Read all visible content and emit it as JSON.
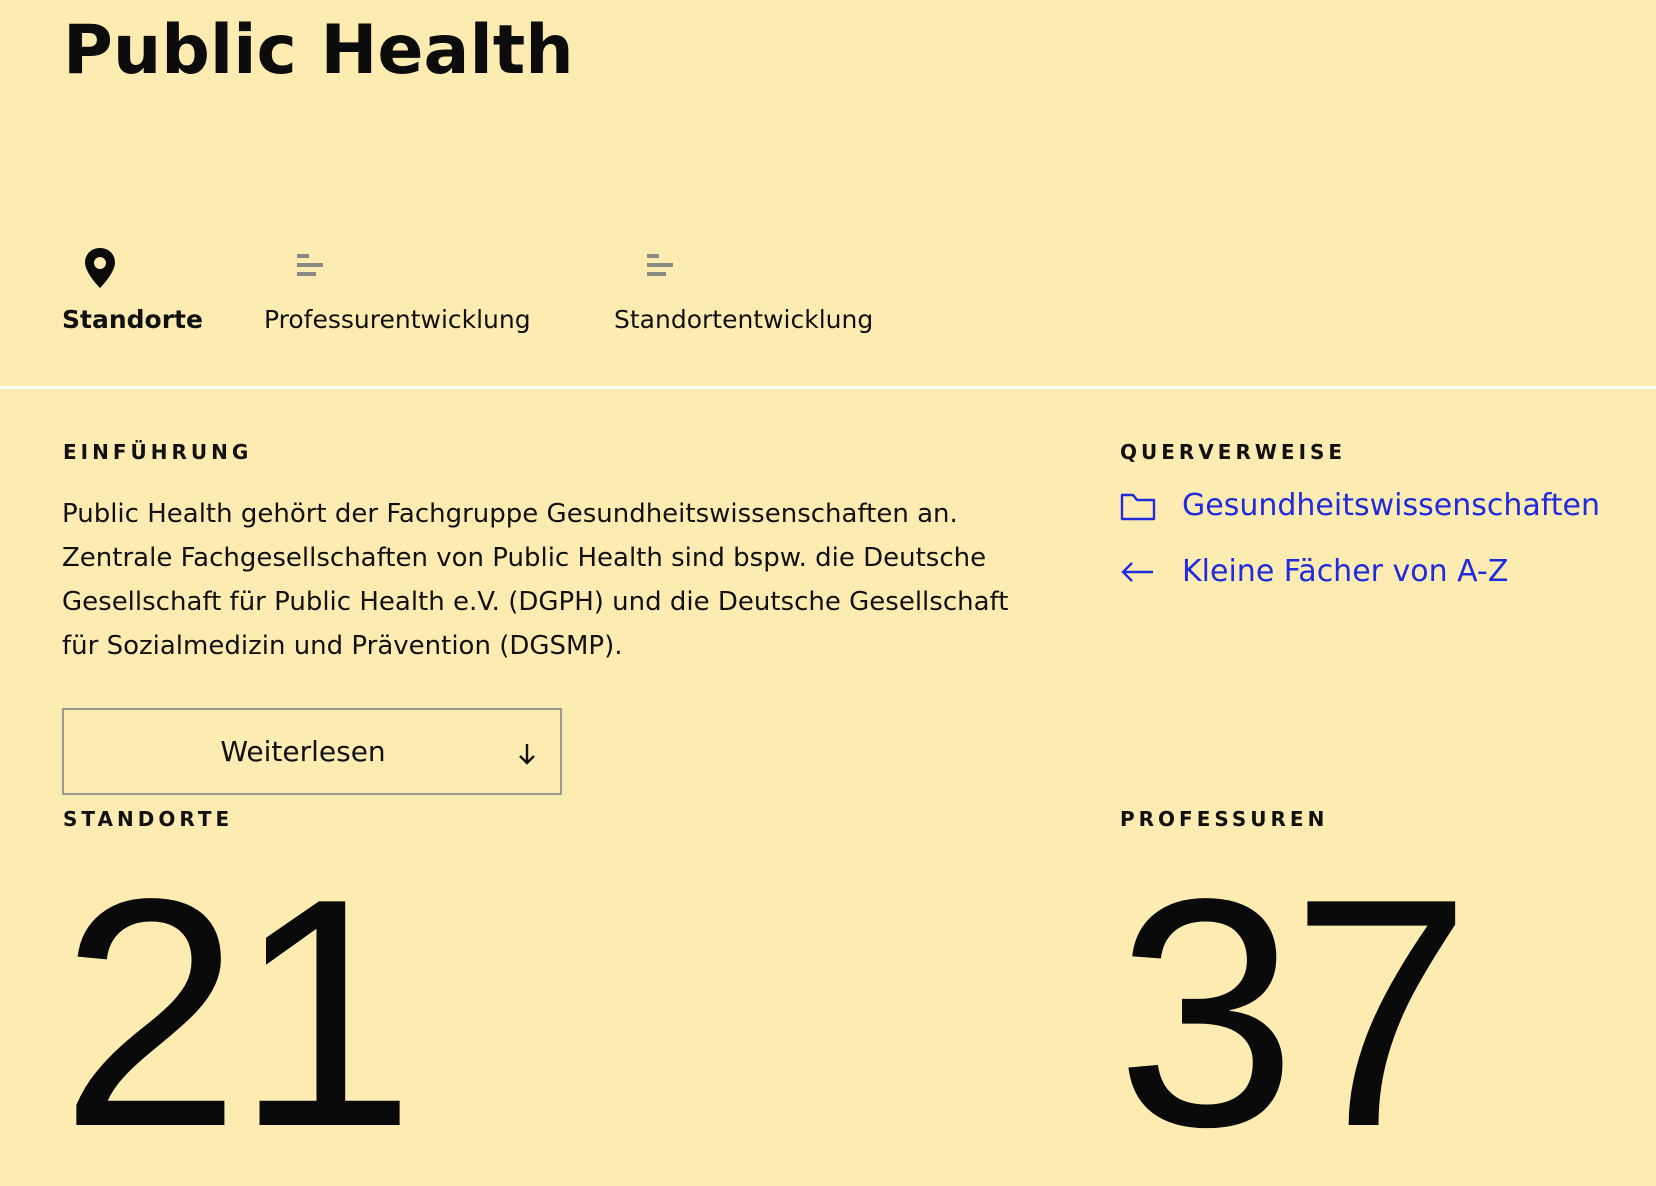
{
  "page": {
    "title": "Public Health"
  },
  "tabs": [
    {
      "label": "Standorte",
      "icon": "map-pin-icon",
      "active": true
    },
    {
      "label": "Professurentwicklung",
      "icon": "bar-chart-icon",
      "active": false
    },
    {
      "label": "Standortentwicklung",
      "icon": "bar-chart-icon",
      "active": false
    }
  ],
  "intro": {
    "heading": "EINFÜHRUNG",
    "text": "Public Health gehört der Fachgruppe Gesundheitswissenschaften an. Zentrale Fachgesellschaften von Public Health sind bspw. die Deutsche Gesellschaft für Public Health e.V. (DGPH) und die Deutsche Gesellschaft für Sozialmedizin und Prävention (DGSMP).",
    "more_label": "Weiterlesen",
    "more_icon": "arrow-down-icon"
  },
  "references": {
    "heading": "QUERVERWEISE",
    "links": [
      {
        "label": "Gesundheitswissenschaften",
        "icon": "folder-icon"
      },
      {
        "label": "Kleine Fächer von A-Z",
        "icon": "arrow-left-icon"
      }
    ]
  },
  "stats": {
    "locations": {
      "label": "STANDORTE",
      "value": "21"
    },
    "professorships": {
      "label": "PROFESSUREN",
      "value": "37"
    }
  },
  "colors": {
    "background": "#fdecb1",
    "text": "#111111",
    "link": "#1f2bdc",
    "divider": "#ffffff",
    "inactive_icon": "#8a8a85"
  }
}
